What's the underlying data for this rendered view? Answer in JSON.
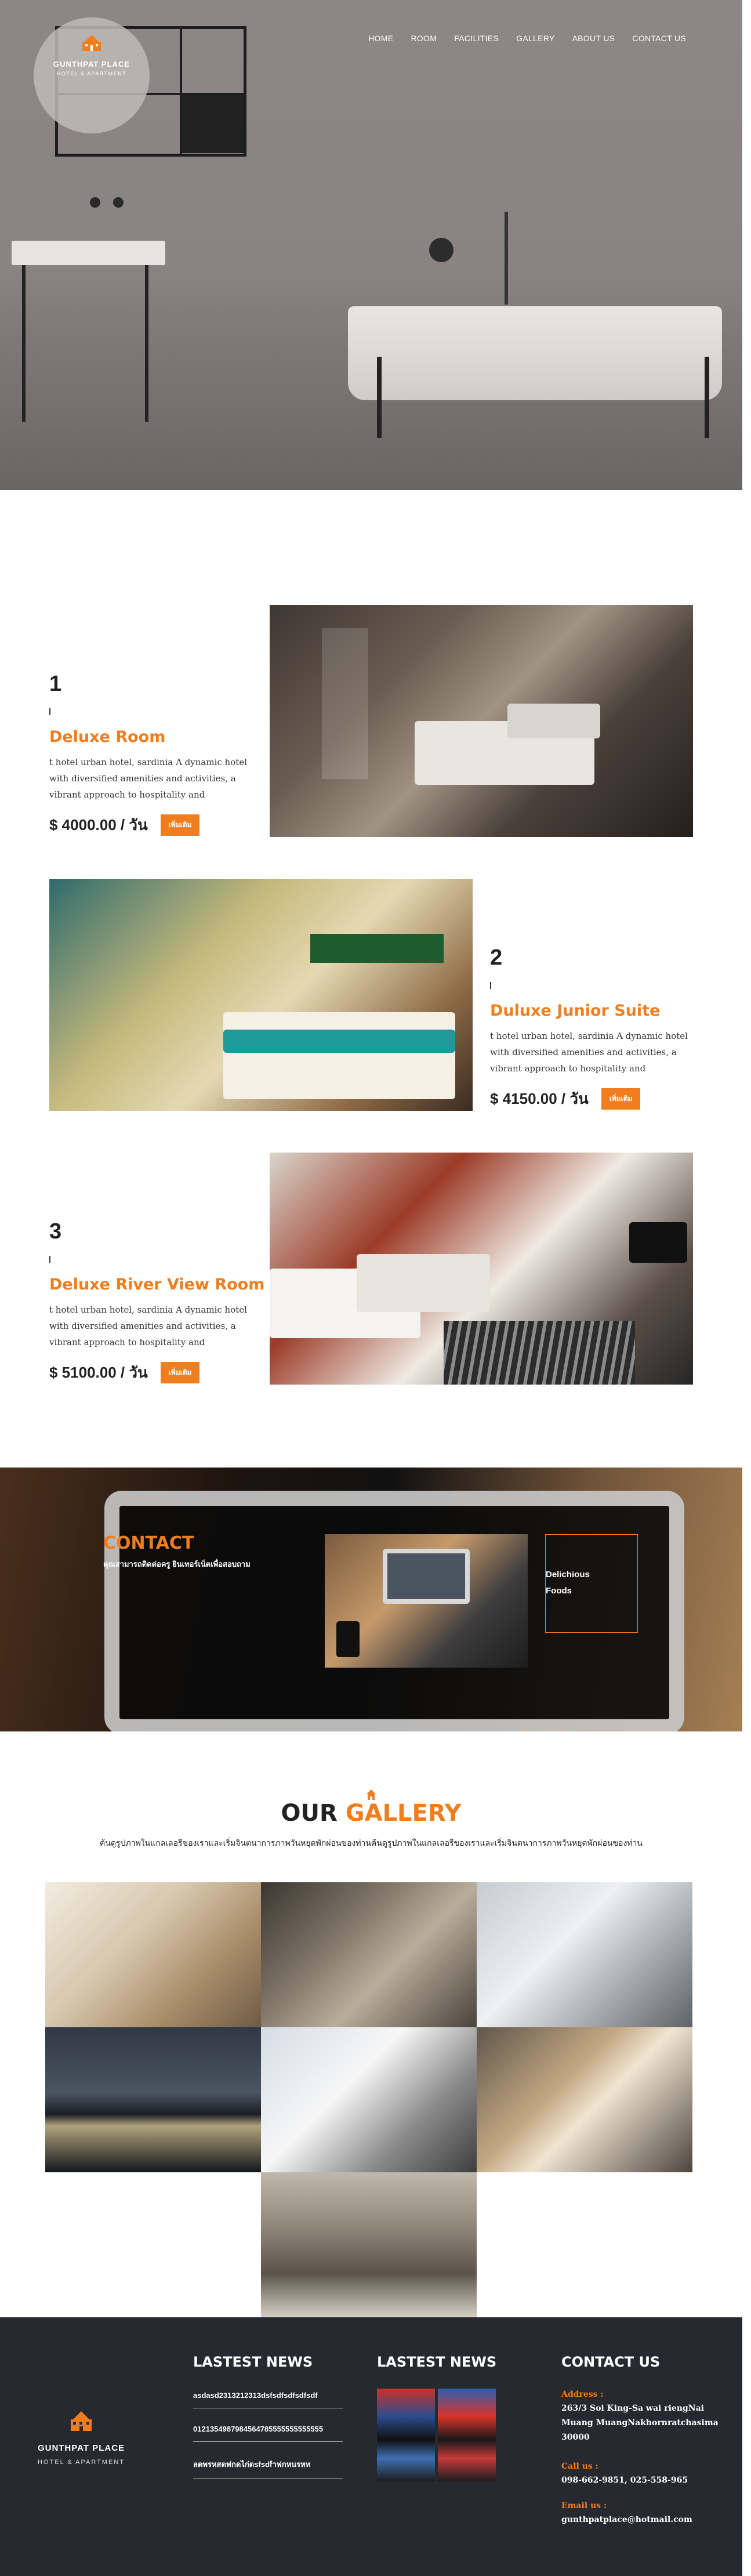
{
  "brand": {
    "name": "GUNTHPAT PLACE",
    "tagline": "HOTEL & APARTMENT",
    "accent_color": "#f07e1e",
    "logo_icon": "building-icon"
  },
  "nav": {
    "items": [
      "HOME",
      "ROOM",
      "FACILITIES",
      "GALLERY",
      "ABOUT US",
      "CONTACT US"
    ]
  },
  "rooms": [
    {
      "number": "1",
      "title": "Deluxe Room",
      "description": "t hotel urban hotel, sardinia A dynamic hotel with diversified amenities and activities, a vibrant approach to hospitality and",
      "price": "$ 4000.00 / วัน",
      "button": "เพิ่มเติม"
    },
    {
      "number": "2",
      "title": "Duluxe Junior Suite",
      "description": "t hotel urban hotel, sardinia A dynamic hotel with diversified amenities and activities, a vibrant approach to hospitality and",
      "price": "$ 4150.00 / วัน",
      "button": "เพิ่มเติม"
    },
    {
      "number": "3",
      "title": "Deluxe River View Room",
      "description": "t hotel urban hotel, sardinia A dynamic hotel with diversified amenities and activities, a vibrant approach to hospitality and",
      "price": "$ 5100.00 / วัน",
      "button": "เพิ่มเติม"
    }
  ],
  "contact_banner": {
    "title": "CONTACT",
    "subtitle": "คุณสามารถติดต่อครู ยินเทอร์เน็ตเพื่อสอบถาม",
    "box_line1": "Delichious",
    "box_line2": "Foods"
  },
  "gallery": {
    "heading_a": "OUR",
    "heading_b": "GALLERY",
    "caption": "ค้นดูรูปภาพในแกลเลอรีของเราและเริ่มจินตนาการภาพวันหยุดพักผ่อนของท่านค้นดูรูปภาพในแกลเลอรีของเราและเริ่มจินตนาการภาพวันหยุดพักผ่อนของท่าน"
  },
  "footer": {
    "news_heading_1": "LASTEST NEWS",
    "news_heading_2": "LASTEST NEWS",
    "news_items": [
      "asdasd2313212313dsfsdfsdfsdfsdf",
      "0121354987984564785555555555555",
      "ลดพรหสดฟกดไก่ดsfsdfำฟกหนรหท"
    ],
    "contact_heading": "CONTACT US",
    "address_label": "Address :",
    "address": "263/3 Soi King-Sa wai riengNai Muang MuangNakhornratchasima 30000",
    "call_label": "Call us :",
    "phone": "098-662-9851, 025-558-965",
    "email_label": "Email us :",
    "email": "gunthpatplace@hotmail.com"
  }
}
